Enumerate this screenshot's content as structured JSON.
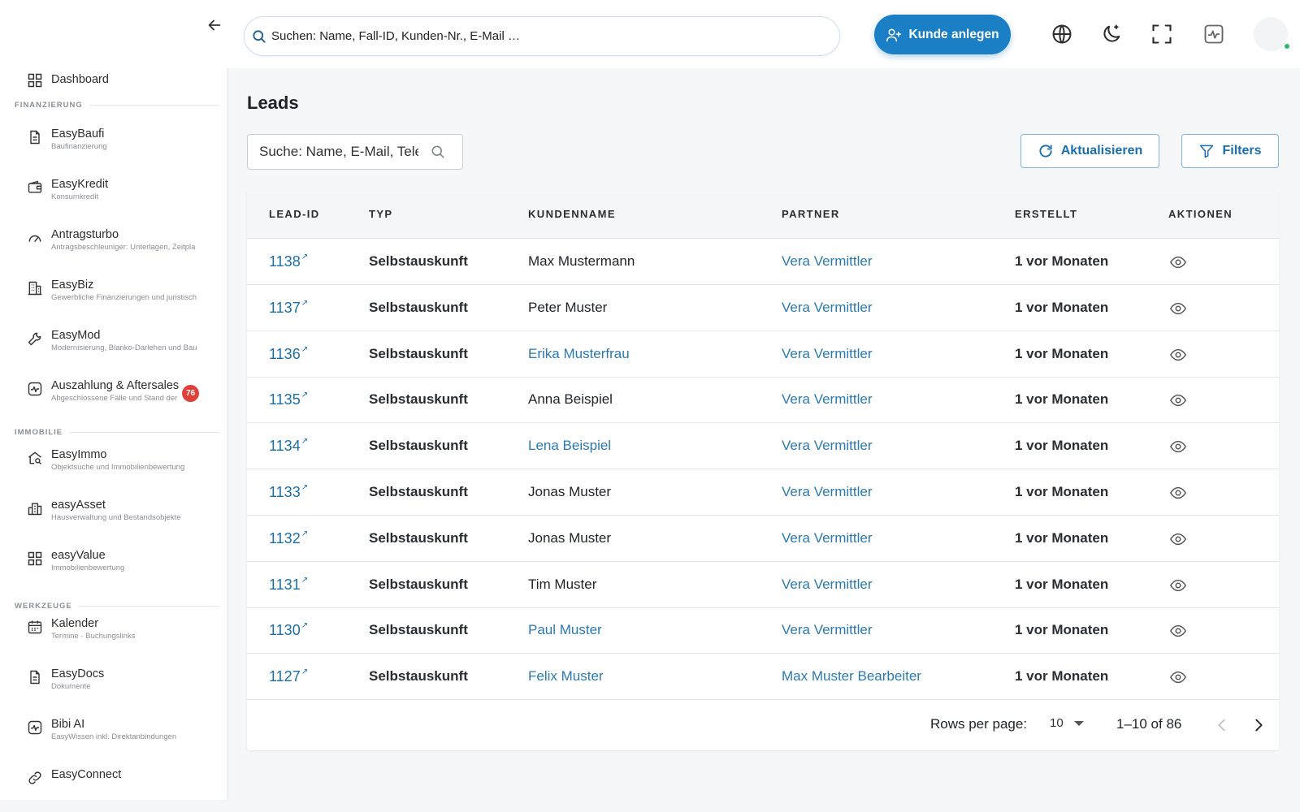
{
  "sidebar": {
    "dashboard": {
      "label": "Dashboard"
    },
    "sections": {
      "finanzierung": "FINANZIERUNG",
      "immobilie": "IMMOBILIE",
      "werkzeuge": "WERKZEUGE"
    },
    "items": [
      {
        "label": "EasyBaufi",
        "sub": "Baufinanzierung"
      },
      {
        "label": "EasyKredit",
        "sub": "Konsumkredit"
      },
      {
        "label": "Antragsturbo",
        "sub": "Antragsbeschleuniger: Unterlagen, Zeitpla"
      },
      {
        "label": "EasyBiz",
        "sub": "Gewerbliche Finanzierungen und juristisch"
      },
      {
        "label": "EasyMod",
        "sub": "Modernisierung, Blanko-Darlehen und Bau"
      },
      {
        "label": "Auszahlung & Aftersales",
        "sub": "Abgeschlossene Fälle und Stand der",
        "badge": "76"
      },
      {
        "label": "EasyImmo",
        "sub": "Objektsuche und Immobilienbewertung"
      },
      {
        "label": "easyAsset",
        "sub": "Hausverwaltung und Bestandsobjekte"
      },
      {
        "label": "easyValue",
        "sub": "Immobilienbewertung"
      },
      {
        "label": "Kalender",
        "sub": "Termine · Buchungslinks"
      },
      {
        "label": "EasyDocs",
        "sub": "Dokumente"
      },
      {
        "label": "Bibi AI",
        "sub": "EasyWissen inkl. Direktanbindungen"
      },
      {
        "label": "EasyConnect",
        "sub": ""
      }
    ]
  },
  "topbar": {
    "search_placeholder": "Suchen: Name, Fall-ID, Kunden-Nr., E-Mail …",
    "create_customer": "Kunde anlegen"
  },
  "main": {
    "title": "Leads",
    "search_placeholder": "Suche: Name, E-Mail, Telefon",
    "refresh": "Aktualisieren",
    "filters": "Filters"
  },
  "table": {
    "columns": [
      "LEAD-ID",
      "TYP",
      "KUNDENNAME",
      "PARTNER",
      "ERSTELLT",
      "AKTIONEN"
    ],
    "rows": [
      {
        "id": "1138",
        "typ": "Selbstauskunft",
        "name": "Max Mustermann",
        "name_link": false,
        "partner": "Vera Vermittler",
        "created": "1 vor Monaten"
      },
      {
        "id": "1137",
        "typ": "Selbstauskunft",
        "name": "Peter Muster",
        "name_link": false,
        "partner": "Vera Vermittler",
        "created": "1 vor Monaten"
      },
      {
        "id": "1136",
        "typ": "Selbstauskunft",
        "name": "Erika Musterfrau",
        "name_link": true,
        "partner": "Vera Vermittler",
        "created": "1 vor Monaten"
      },
      {
        "id": "1135",
        "typ": "Selbstauskunft",
        "name": "Anna Beispiel",
        "name_link": false,
        "partner": "Vera Vermittler",
        "created": "1 vor Monaten"
      },
      {
        "id": "1134",
        "typ": "Selbstauskunft",
        "name": "Lena Beispiel",
        "name_link": true,
        "partner": "Vera Vermittler",
        "created": "1 vor Monaten"
      },
      {
        "id": "1133",
        "typ": "Selbstauskunft",
        "name": "Jonas Muster",
        "name_link": false,
        "partner": "Vera Vermittler",
        "created": "1 vor Monaten"
      },
      {
        "id": "1132",
        "typ": "Selbstauskunft",
        "name": "Jonas Muster",
        "name_link": false,
        "partner": "Vera Vermittler",
        "created": "1 vor Monaten"
      },
      {
        "id": "1131",
        "typ": "Selbstauskunft",
        "name": "Tim Muster",
        "name_link": false,
        "partner": "Vera Vermittler",
        "created": "1 vor Monaten"
      },
      {
        "id": "1130",
        "typ": "Selbstauskunft",
        "name": "Paul Muster",
        "name_link": true,
        "partner": "Vera Vermittler",
        "created": "1 vor Monaten"
      },
      {
        "id": "1127",
        "typ": "Selbstauskunft",
        "name": "Felix Muster",
        "name_link": true,
        "partner": "Max Muster Bearbeiter",
        "created": "1 vor Monaten"
      }
    ],
    "footer": {
      "rows_per_page_label": "Rows per page:",
      "rows_per_page_value": "10",
      "page_info": "1–10 of 86"
    }
  },
  "colors": {
    "primary": "#1a7fc4",
    "link": "#2a7ab0",
    "badge": "#e0403a",
    "online": "#2eb872"
  }
}
